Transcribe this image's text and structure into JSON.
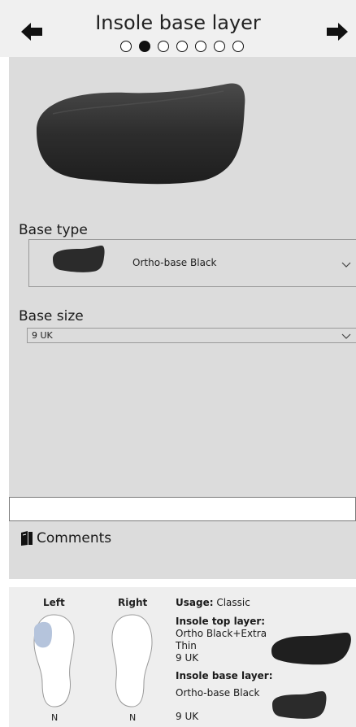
{
  "header": {
    "title": "Insole base layer",
    "step_count": 7,
    "active_step": 1,
    "prev_icon": "arrow-left-icon",
    "next_icon": "arrow-right-icon"
  },
  "form": {
    "base_type": {
      "label": "Base type",
      "value": "Ortho-base Black"
    },
    "base_size": {
      "label": "Base size",
      "value": "9 UK"
    },
    "comments": {
      "label": "Comments",
      "value": ""
    }
  },
  "footer": {
    "left_label": "Left",
    "right_label": "Right",
    "left_width": "N",
    "right_width": "N",
    "usage_label": "Usage:",
    "usage_value": "Classic",
    "top_layer_label": "Insole top layer:",
    "top_layer_name_line1": "Ortho Black+Extra",
    "top_layer_name_line2": "Thin",
    "top_layer_size": "9 UK",
    "base_layer_label": "Insole base layer:",
    "base_layer_name": "Ortho-base Black",
    "base_layer_size": "9 UK"
  },
  "colors": {
    "panel": "#dcdcdc",
    "header": "#f0f0f0",
    "footer": "#eeeeee",
    "insole": "#2b2b2b",
    "foot_highlight": "#b5c4dc"
  }
}
